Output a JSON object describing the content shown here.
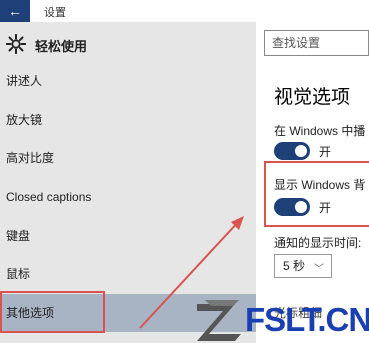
{
  "window": {
    "back_icon": "←",
    "title": "设置"
  },
  "header": {
    "title": "轻松使用",
    "icon": "gear-icon"
  },
  "search": {
    "placeholder": "查找设置"
  },
  "sidebar": {
    "items": [
      {
        "label": "讲述人"
      },
      {
        "label": "放大镜"
      },
      {
        "label": "高对比度"
      },
      {
        "label": "Closed captions"
      },
      {
        "label": "键盘"
      },
      {
        "label": "鼠标"
      },
      {
        "label": "其他选项",
        "active": true
      }
    ]
  },
  "main": {
    "heading": "视觉选项",
    "settings": [
      {
        "label": "在 Windows 中播",
        "toggle": "开"
      },
      {
        "label": "显示 Windows 背",
        "toggle": "开"
      }
    ],
    "notify_label": "通知的显示时间:",
    "notify_value": "5 秒",
    "cursor_label": "光标粗细"
  },
  "watermark": {
    "text": "FSLT.CN"
  },
  "colors": {
    "accent": "#1e3f78",
    "annotation": "#d9534f",
    "sidebar_bg": "#e6e6e6",
    "active_item": "#a8b4c4",
    "watermark": "#1a3fb0"
  }
}
